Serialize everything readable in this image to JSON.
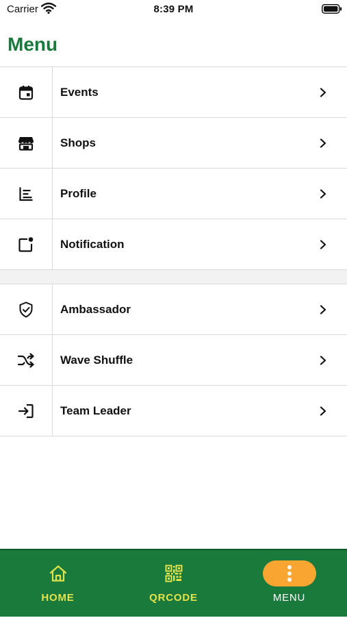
{
  "status_bar": {
    "carrier": "Carrier",
    "time": "8:39 PM"
  },
  "header": {
    "title": "Menu"
  },
  "menu": {
    "groups": [
      {
        "items": [
          {
            "label": "Events",
            "icon": "calendar-icon"
          },
          {
            "label": "Shops",
            "icon": "storefront-icon"
          },
          {
            "label": "Profile",
            "icon": "profile-list-icon"
          },
          {
            "label": "Notification",
            "icon": "notification-dot-icon"
          }
        ]
      },
      {
        "items": [
          {
            "label": "Ambassador",
            "icon": "shield-check-icon"
          },
          {
            "label": "Wave Shuffle",
            "icon": "shuffle-icon"
          },
          {
            "label": "Team Leader",
            "icon": "login-icon"
          }
        ]
      }
    ]
  },
  "tab_bar": {
    "tabs": [
      {
        "label": "HOME",
        "icon": "home-icon",
        "active": false
      },
      {
        "label": "QRCODE",
        "icon": "qrcode-icon",
        "active": false
      },
      {
        "label": "MENU",
        "icon": "more-vertical-icon",
        "active": true
      }
    ]
  },
  "colors": {
    "brand_green": "#1a7a3c",
    "tab_label_yellow": "#e2e34a",
    "active_pill": "#f8a531"
  }
}
